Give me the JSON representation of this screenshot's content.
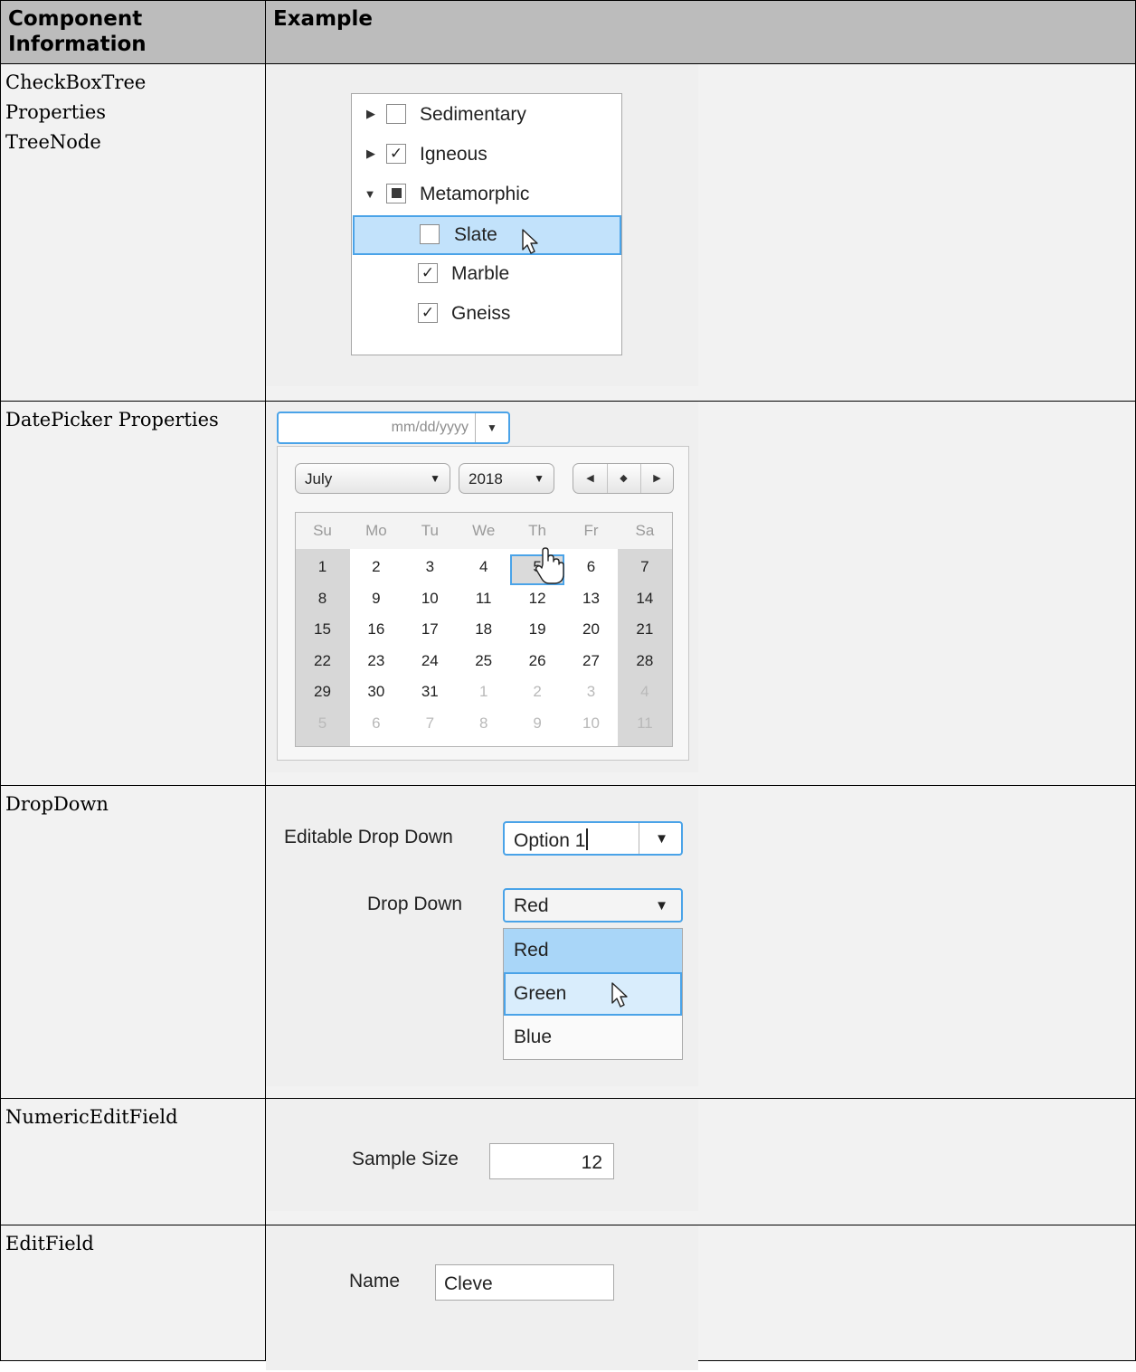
{
  "table": {
    "headers": [
      "Component Information",
      "Example"
    ]
  },
  "rows": {
    "checkbox_tree": {
      "info": [
        "CheckBoxTree",
        "Properties",
        "TreeNode"
      ],
      "nodes": [
        {
          "label": "Sedimentary",
          "expander": "collapsed",
          "check": "unchecked"
        },
        {
          "label": "Igneous",
          "expander": "collapsed",
          "check": "checked"
        },
        {
          "label": "Metamorphic",
          "expander": "expanded",
          "check": "partial"
        },
        {
          "label": "Slate",
          "check": "unchecked",
          "selected": true
        },
        {
          "label": "Marble",
          "check": "checked"
        },
        {
          "label": "Gneiss",
          "check": "checked"
        }
      ]
    },
    "date_picker": {
      "info": "DatePicker Properties",
      "placeholder": "mm/dd/yyyy",
      "month": "July",
      "year": "2018",
      "weekdays": [
        "Su",
        "Mo",
        "Tu",
        "We",
        "Th",
        "Fr",
        "Sa"
      ],
      "weeks": [
        [
          "1",
          "2",
          "3",
          "4",
          "5",
          "6",
          "7"
        ],
        [
          "8",
          "9",
          "10",
          "11",
          "12",
          "13",
          "14"
        ],
        [
          "15",
          "16",
          "17",
          "18",
          "19",
          "20",
          "21"
        ],
        [
          "22",
          "23",
          "24",
          "25",
          "26",
          "27",
          "28"
        ],
        [
          "29",
          "30",
          "31",
          "1",
          "2",
          "3",
          "4"
        ],
        [
          "5",
          "6",
          "7",
          "8",
          "9",
          "10",
          "11"
        ]
      ],
      "highlighted_day": "5"
    },
    "dropdown": {
      "info": "DropDown",
      "editable_label": "Editable Drop Down",
      "editable_value": "Option 1",
      "label": "Drop Down",
      "value": "Red",
      "options": [
        "Red",
        "Green",
        "Blue"
      ],
      "hovered_option": "Green"
    },
    "numeric": {
      "info": "NumericEditField",
      "label": "Sample Size",
      "value": "12"
    },
    "edit": {
      "info": "EditField",
      "label": "Name",
      "value": "Cleve"
    }
  },
  "icons": {
    "collapsed": "caret-right-icon",
    "expanded": "caret-down-icon",
    "dropdown": "caret-down-icon",
    "cursor": "mouse-pointer-icon",
    "hand": "hand-pointer-icon",
    "nav": [
      "previous-icon",
      "today-icon",
      "next-icon"
    ]
  },
  "colors": {
    "header_bg": "#bcbcbc",
    "focus_border": "#4aa3e8",
    "selection": "#c2e2fb"
  }
}
